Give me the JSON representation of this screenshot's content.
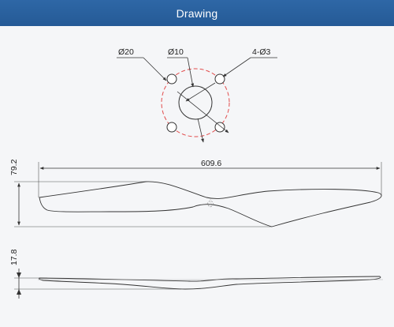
{
  "window": {
    "title": "Drawing"
  },
  "colors": {
    "title_bar": "#2a60a0",
    "title_text": "#ffffff",
    "background": "#f5f6f8",
    "line": "#444444",
    "centerline": "#e24c4c"
  },
  "hub_view": {
    "bore_label": "Ø20",
    "center_label": "Ø10",
    "holes_label": "4-Ø3"
  },
  "top_view": {
    "span_label": "609.6",
    "chord_label": "79.2"
  },
  "side_view": {
    "thickness_label": "17.8"
  }
}
